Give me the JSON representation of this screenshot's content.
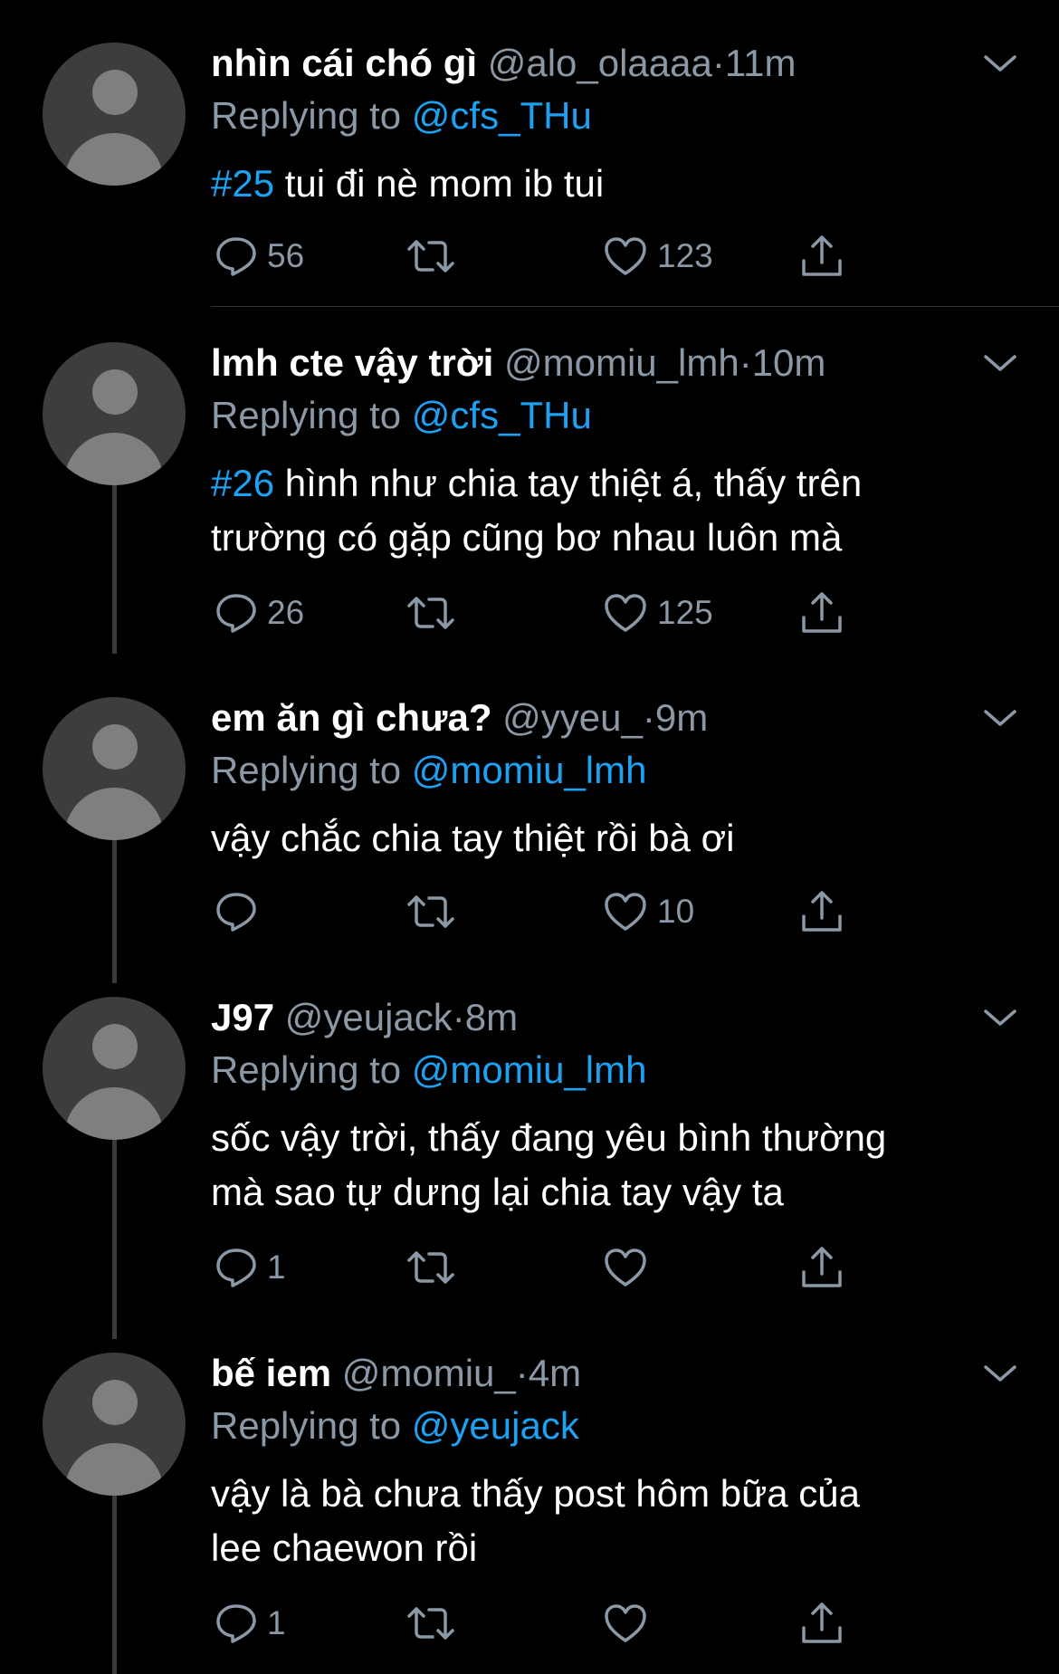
{
  "tweets": [
    {
      "name": "nhìn cái chó gì",
      "handle": "@alo_olaaaa",
      "time": "11m",
      "replying_prefix": "Replying to",
      "replying_to": "@cfs_THu",
      "tag": "#25",
      "text_lines": [
        "tui đi nè mom ib tui"
      ],
      "replies": "56",
      "likes": "123"
    },
    {
      "name": "lmh cte vậy trời",
      "handle": "@momiu_lmh",
      "time": "10m",
      "replying_prefix": "Replying to",
      "replying_to": "@cfs_THu",
      "tag": "#26",
      "text_lines": [
        "hình như chia tay thiệt á, thấy trên",
        "trường có gặp cũng bơ nhau luôn mà"
      ],
      "replies": "26",
      "likes": "125"
    },
    {
      "name": "em ăn gì chưa?",
      "handle": "@yyeu_",
      "time": "9m",
      "replying_prefix": "Replying to",
      "replying_to": "@momiu_lmh",
      "tag": "",
      "text_lines": [
        "vậy chắc chia tay thiệt rồi bà ơi"
      ],
      "replies": "",
      "likes": "10"
    },
    {
      "name": "J97",
      "handle": "@yeujack",
      "time": "8m",
      "replying_prefix": "Replying to",
      "replying_to": "@momiu_lmh",
      "tag": "",
      "text_lines": [
        "sốc vậy trời, thấy đang yêu bình thường",
        "mà sao tự dưng lại chia tay vậy ta"
      ],
      "replies": "1",
      "likes": ""
    },
    {
      "name": "bế iem",
      "handle": "@momiu_",
      "time": "4m",
      "replying_prefix": "Replying to",
      "replying_to": "@yeujack",
      "tag": "",
      "text_lines": [
        "vậy là bà chưa thấy post hôm bữa của",
        "lee chaewon rồi"
      ],
      "replies": "1",
      "likes": ""
    }
  ],
  "separator": "·",
  "icons": {
    "reply": "reply-icon",
    "retweet": "retweet-icon",
    "like": "heart-icon",
    "share": "share-icon",
    "more": "chevron-down-icon",
    "avatar": "default-avatar"
  },
  "colors": {
    "background": "#000000",
    "text": "#ffffff",
    "muted": "#8b98a5",
    "link": "#1da1f2",
    "avatar_bg": "#3d3d3d",
    "avatar_fg": "#7f7f7f"
  }
}
